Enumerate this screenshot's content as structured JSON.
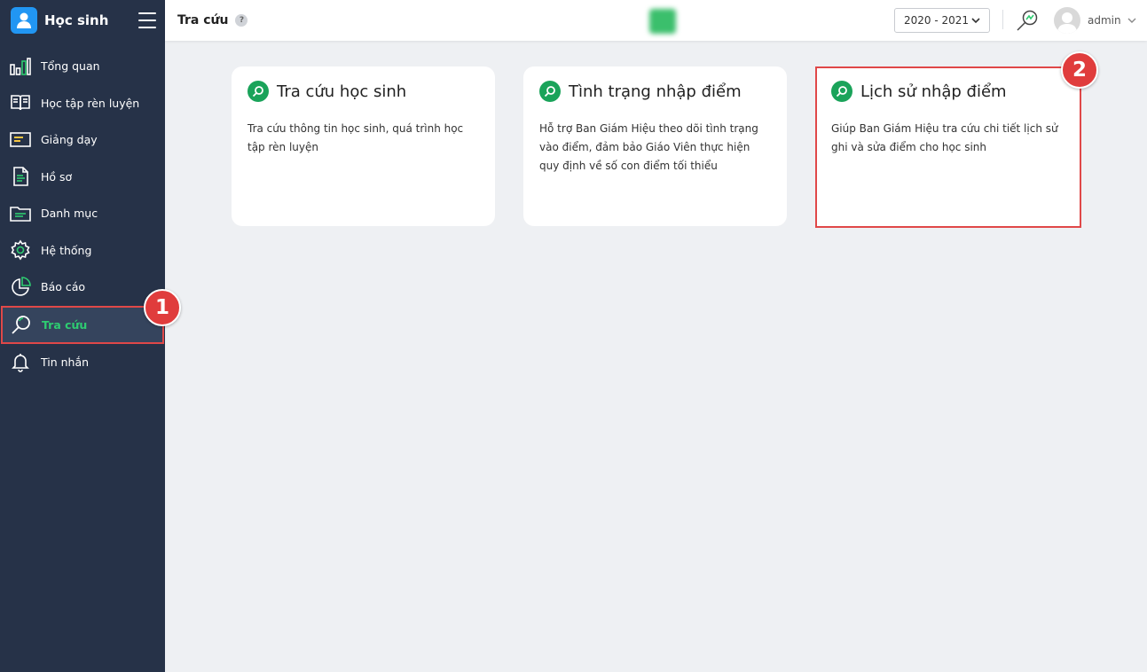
{
  "app": {
    "name": "Học sinh"
  },
  "sidebar": {
    "items": [
      {
        "label": "Tổng quan",
        "icon": "bar-chart-icon"
      },
      {
        "label": "Học tập rèn luyện",
        "icon": "book-icon"
      },
      {
        "label": "Giảng dạy",
        "icon": "whiteboard-icon"
      },
      {
        "label": "Hồ sơ",
        "icon": "document-icon"
      },
      {
        "label": "Danh mục",
        "icon": "folder-icon"
      },
      {
        "label": "Hệ thống",
        "icon": "gear-icon"
      },
      {
        "label": "Báo cáo",
        "icon": "pie-chart-icon"
      },
      {
        "label": "Tra cứu",
        "icon": "search-icon",
        "active": true
      },
      {
        "label": "Tin nhắn",
        "icon": "bell-icon"
      }
    ]
  },
  "header": {
    "title": "Tra cứu",
    "help": "?",
    "school_year": "2020 - 2021",
    "user": "admin"
  },
  "cards": [
    {
      "title": "Tra cứu học sinh",
      "description": "Tra cứu thông tin học sinh, quá trình học tập rèn luyện"
    },
    {
      "title": "Tình trạng nhập điểm",
      "description": "Hỗ trợ Ban Giám Hiệu theo dõi tình trạng vào điểm, đảm bảo Giáo Viên thực hiện quy định về số con điểm tối thiểu"
    },
    {
      "title": "Lịch sử nhập điểm",
      "description": "Giúp Ban Giám Hiệu tra cứu chi tiết lịch sử ghi và sửa điểm cho học sinh"
    }
  ],
  "annotations": {
    "step1": "1",
    "step2": "2"
  },
  "colors": {
    "sidebar": "#263248",
    "accent_green": "#1aa35a",
    "highlight_red": "#e04848",
    "background": "#eef0f3"
  }
}
